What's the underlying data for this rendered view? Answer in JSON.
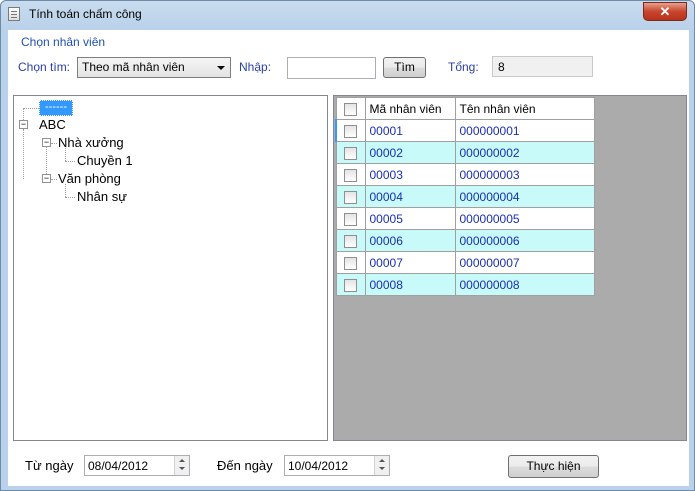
{
  "window": {
    "title": "Tính toán chấm công",
    "close_label": "✕"
  },
  "filter": {
    "group_title": "Chọn nhân viên",
    "search_by_label": "Chọn tìm:",
    "search_by_value": "Theo mã nhân viên",
    "input_label": "Nhập:",
    "input_value": "",
    "search_button": "Tìm",
    "total_label": "Tổng:",
    "total_value": "8"
  },
  "tree": {
    "root": "------",
    "nodes": [
      "ABC",
      "Nhà xưởng",
      "Chuyền 1",
      "Văn phòng",
      "Nhân sự"
    ]
  },
  "grid": {
    "columns": [
      "Mã nhân viên",
      "Tên nhân viên"
    ],
    "rows": [
      [
        "00001",
        "000000001"
      ],
      [
        "00002",
        "000000002"
      ],
      [
        "00003",
        "000000003"
      ],
      [
        "00004",
        "000000004"
      ],
      [
        "00005",
        "000000005"
      ],
      [
        "00006",
        "000000006"
      ],
      [
        "00007",
        "000000007"
      ],
      [
        "00008",
        "000000008"
      ]
    ]
  },
  "dates": {
    "from_label": "Từ ngày",
    "from_value": "08/04/2012",
    "to_label": "Đến ngày",
    "to_value": "10/04/2012"
  },
  "execute_button": "Thực hiện",
  "colors": {
    "row_alt": "#c8fafa",
    "link_text": "#1a2fb0",
    "selection": "#3399ff"
  }
}
